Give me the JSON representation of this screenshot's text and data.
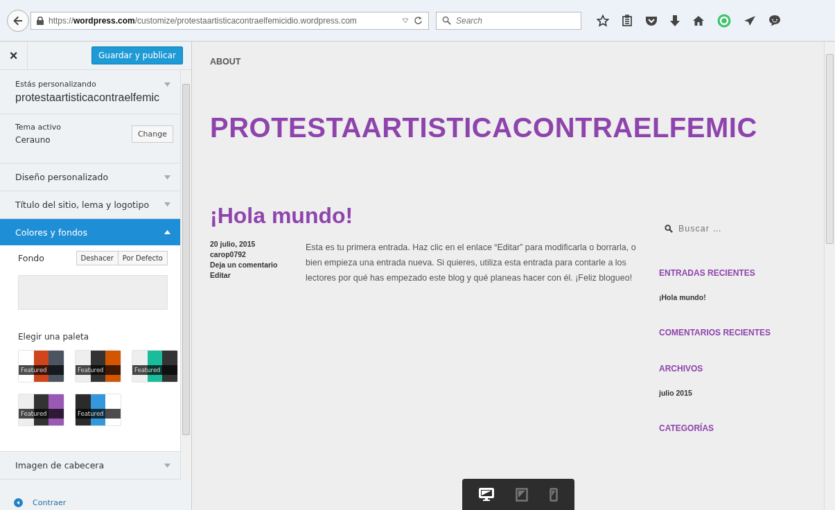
{
  "browser": {
    "url": "https://**wordpress.com**/customize/protestaartisticacontraelfemicidio.wordpress.com",
    "search": {
      "placeholder": "Search"
    }
  },
  "customizer": {
    "close": "×",
    "save_button": "Guardar y publicar",
    "customizing": {
      "label": "Estás personalizando",
      "site": "protestaartisticacontraelfemic"
    },
    "theme": {
      "label": "Tema activo",
      "name": "Cerauno",
      "button": "Change"
    },
    "sections": [
      {
        "title": "Diseño personalizado",
        "expanded": false
      },
      {
        "title": "Título del sitio, lema y logotipo",
        "expanded": false
      },
      {
        "title": "Colores y fondos",
        "expanded": true
      },
      {
        "title": "Imagen de cabecera",
        "expanded": false
      }
    ],
    "background": {
      "label": "Fondo",
      "buttons": [
        "Deshacer",
        "Por Defecto"
      ]
    },
    "palette_title": "Elegir una paleta",
    "palettes": [
      {
        "label": "Featured",
        "swatches": [
          {
            "color": "#ffffff"
          },
          {
            "color": "#d0451b"
          },
          {
            "color": "#4a5561"
          }
        ]
      },
      {
        "label": "Featured",
        "swatches": [
          {
            "color": "#eeeeee"
          },
          {
            "color": "#333333"
          },
          {
            "color": "#d45500"
          }
        ]
      },
      {
        "label": "Featured",
        "swatches": [
          {
            "color": "#eeeeee"
          },
          {
            "color": "#1abc9c"
          },
          {
            "color": "#333333"
          }
        ]
      },
      {
        "label": "Featured",
        "swatches": [
          {
            "color": "#eeeeee"
          },
          {
            "color": "#333333"
          },
          {
            "color": "#9b59b6"
          }
        ]
      },
      {
        "label": "Featured",
        "swatches": [
          {
            "color": "#2b2b2b"
          },
          {
            "color": "#3498db"
          },
          {
            "color": "#ffffff"
          }
        ]
      }
    ],
    "collapse": "Contraer"
  },
  "preview": {
    "menu": "ABOUT",
    "site_title": "PROTESTAARTISTICACONTRAELFEMIC",
    "post": {
      "title": "¡Hola mundo!",
      "meta": [
        "20 julio, 2015",
        "carop0792",
        "Deja un comentario",
        "Editar"
      ],
      "body": "Esta es tu primera entrada. Haz clic en el enlace “Editar” para modificarla o borrarla, o bien empieza una entrada nueva. Si quieres, utiliza esta entrada para contarle a los lectores por qué has empezado este blog y qué planeas hacer con él. ¡Feliz blogueo!"
    },
    "search": {
      "placeholder": "Buscar …"
    },
    "widgets": [
      {
        "title": "ENTRADAS RECIENTES",
        "items": [
          "¡Hola mundo!"
        ]
      },
      {
        "title": "COMENTARIOS RECIENTES"
      },
      {
        "title": "ARCHIVOS",
        "items": [
          "julio 2015"
        ]
      },
      {
        "title": "CATEGORÍAS"
      }
    ],
    "devices": [
      {
        "kind": "desktop",
        "selected": true
      },
      {
        "kind": "tablet",
        "selected": false
      },
      {
        "kind": "mobile",
        "selected": false
      }
    ]
  }
}
